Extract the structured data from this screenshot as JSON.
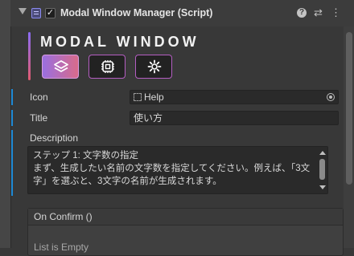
{
  "component": {
    "title": "Modal Window Manager (Script)",
    "enabled_check": "✓",
    "help_icon": "help-icon",
    "preset_icon": "preset-icon",
    "menu_icon": "kebab-menu-icon"
  },
  "banner": {
    "title": "MODAL WINDOW",
    "tabs": [
      {
        "icon": "layers-icon",
        "active": true
      },
      {
        "icon": "chip-icon",
        "active": false
      },
      {
        "icon": "gear-icon",
        "active": false
      }
    ]
  },
  "fields": {
    "icon": {
      "label": "Icon",
      "value": "Help"
    },
    "title": {
      "label": "Title",
      "value": "使い方"
    },
    "description": {
      "label": "Description",
      "value": "ステップ 1: 文字数の指定\nまず、生成したい名前の文字数を指定してください。例えば、「3文字」を選ぶと、3文字の名前が生成されます。"
    }
  },
  "on_confirm": {
    "title": "On Confirm ()",
    "empty_text": "List is Empty"
  },
  "colors": {
    "accent_start": "#9a6fe0",
    "accent_end": "#d86b8a",
    "modified_marker": "#1e8ad6"
  }
}
